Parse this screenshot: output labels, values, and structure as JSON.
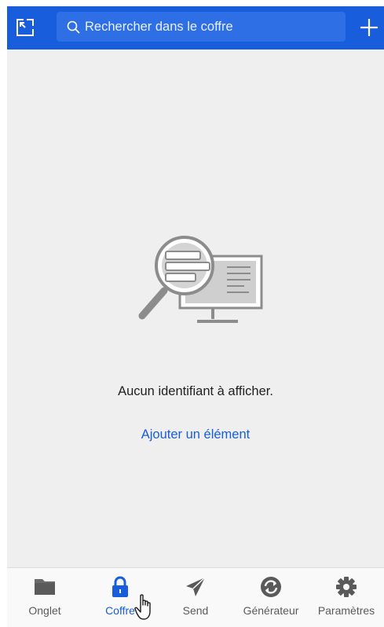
{
  "header": {
    "search": {
      "placeholder": "Rechercher dans le coffre",
      "value": ""
    },
    "popout_icon": "popout-icon",
    "add_icon": "plus-icon"
  },
  "empty_state": {
    "message": "Aucun identifiant à afficher.",
    "add_link": "Ajouter un élément",
    "illustration": "magnifier-monitor-illustration"
  },
  "tabs": [
    {
      "label": "Onglet",
      "icon": "folder-icon",
      "active": false
    },
    {
      "label": "Coffre",
      "icon": "lock-icon",
      "active": true
    },
    {
      "label": "Send",
      "icon": "send-icon",
      "active": false
    },
    {
      "label": "Générateur",
      "icon": "generator-icon",
      "active": false
    },
    {
      "label": "Paramètres",
      "icon": "gear-icon",
      "active": false
    }
  ],
  "colors": {
    "brand": "#175ddc",
    "background": "#efefef",
    "tabbar": "#f9f9f9",
    "inactive": "#5a5a5a"
  }
}
